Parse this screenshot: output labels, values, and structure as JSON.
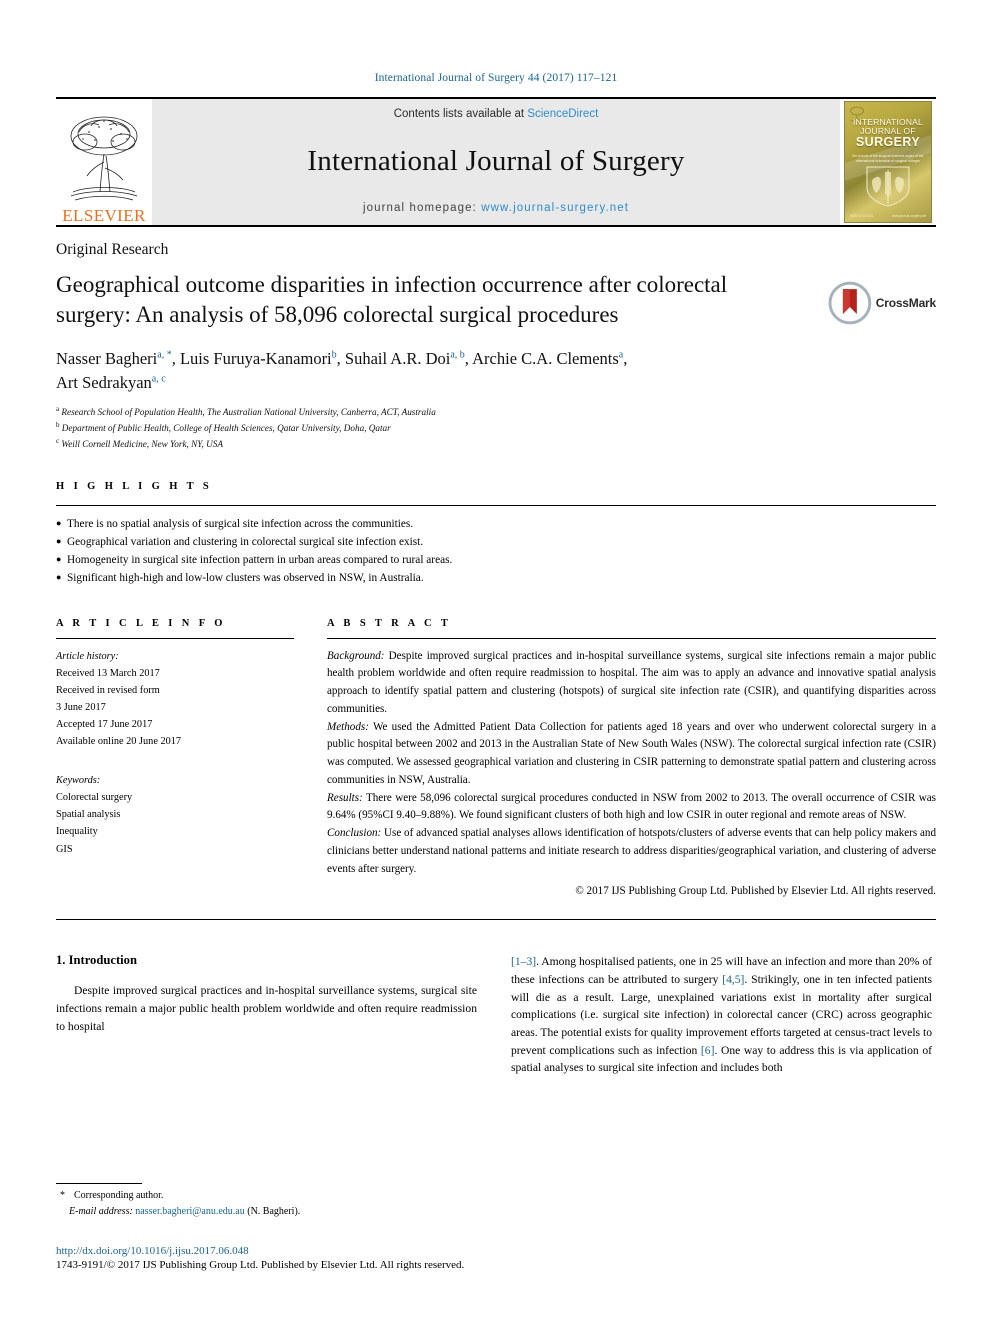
{
  "running_head": "International Journal of Surgery 44 (2017) 117–121",
  "masthead": {
    "publisher": "ELSEVIER",
    "contents_prefix": "Contents lists available at ",
    "contents_link": "ScienceDirect",
    "journal_title": "International Journal of Surgery",
    "homepage_label": "journal homepage: ",
    "homepage_url": "www.journal-surgery.net",
    "cover": {
      "line1": "INTERNATIONAL",
      "line2": "JOURNAL OF",
      "line3": "SURGERY",
      "subtitle": "the journal of the surgical sciences\norgan of the international federation of surgical colleges",
      "footer_left": "ISSN 1743-9191",
      "footer_right": "www.journal-surgery.net"
    }
  },
  "article": {
    "kind": "Original Research",
    "title": "Geographical outcome disparities in infection occurrence after colorectal surgery: An analysis of 58,096 colorectal surgical procedures",
    "crossmark_label": "CrossMark",
    "authors_line1_a": "Nasser Bagheri",
    "authors_line1_a_sup": "a, *",
    "authors_line1_b": ", Luis Furuya-Kanamori",
    "authors_line1_b_sup": "b",
    "authors_line1_c": ", Suhail A.R. Doi",
    "authors_line1_c_sup": "a, b",
    "authors_line1_d": ", Archie C.A. Clements",
    "authors_line1_d_sup": "a",
    "authors_line1_e": ",",
    "authors_line2_a": "Art Sedrakyan",
    "authors_line2_a_sup": "a, c",
    "affiliations": [
      {
        "marker": "a",
        "text": "Research School of Population Health, The Australian National University, Canberra, ACT, Australia"
      },
      {
        "marker": "b",
        "text": "Department of Public Health, College of Health Sciences, Qatar University, Doha, Qatar"
      },
      {
        "marker": "c",
        "text": "Weill Cornell Medicine, New York, NY, USA"
      }
    ]
  },
  "highlights": {
    "label": "H I G H L I G H T S",
    "bullet": "●",
    "items": [
      "There is no spatial analysis of surgical site infection across the communities.",
      "Geographical variation and clustering in colorectal surgical site infection exist.",
      "Homogeneity in surgical site infection pattern in urban areas compared to rural areas.",
      "Significant high-high and low-low clusters was observed in NSW, in Australia."
    ]
  },
  "article_info": {
    "label": "A R T I C L E  I N F O",
    "history_label": "Article history:",
    "history_lines": [
      "Received 13 March 2017",
      "Received in revised form",
      "3 June 2017",
      "Accepted 17 June 2017",
      "Available online 20 June 2017"
    ],
    "keywords_label": "Keywords:",
    "keywords": [
      "Colorectal surgery",
      "Spatial analysis",
      "Inequality",
      "GIS"
    ]
  },
  "abstract": {
    "label": "A B S T R A C T",
    "sections": [
      {
        "lead": "Background:",
        "text": " Despite improved surgical practices and in-hospital surveillance systems, surgical site infections remain a major public health problem worldwide and often require readmission to hospital. The aim was to apply an advance and innovative spatial analysis approach to identify spatial pattern and clustering (hotspots) of surgical site infection rate (CSIR), and quantifying disparities across communities."
      },
      {
        "lead": "Methods:",
        "text": " We used the Admitted Patient Data Collection for patients aged 18 years and over who underwent colorectal surgery in a public hospital between 2002 and 2013 in the Australian State of New South Wales (NSW). The colorectal surgical infection rate (CSIR) was computed. We assessed geographical variation and clustering in CSIR patterning to demonstrate spatial pattern and clustering across communities in NSW, Australia."
      },
      {
        "lead": "Results:",
        "text": " There were 58,096 colorectal surgical procedures conducted in NSW from 2002 to 2013. The overall occurrence of CSIR was 9.64% (95%CI 9.40–9.88%). We found significant clusters of both high and low CSIR in outer regional and remote areas of NSW."
      },
      {
        "lead": "Conclusion:",
        "text": " Use of advanced spatial analyses allows identification of hotspots/clusters of adverse events that can help policy makers and clinicians better understand national patterns and initiate research to address disparities/geographical variation, and clustering of adverse events after surgery."
      }
    ],
    "copyright": "© 2017 IJS Publishing Group Ltd. Published by Elsevier Ltd. All rights reserved."
  },
  "body": {
    "section_heading": "1. Introduction",
    "left_paragraph_part1": "Despite improved surgical practices and in-hospital surveillance systems, surgical site infections remain a major public health problem worldwide and often require readmission to hospital",
    "right_ref_1": "[1–3]",
    "right_text_1": ". Among hospitalised patients, one in 25 will have an infection and more than 20% of these infections can be attributed to surgery ",
    "right_ref_2": "[4,5]",
    "right_text_2": ". Strikingly, one in ten infected patients will die as a result. Large, unexplained variations exist in mortality after surgical complications (i.e. surgical site infection) in colorectal cancer (CRC) across geographic areas. The potential exists for quality improvement efforts targeted at census-tract levels to prevent complications such as infection ",
    "right_ref_3": "[6]",
    "right_text_3": ". One way to address this is via application of spatial analyses to surgical site infection and includes both"
  },
  "footnote": {
    "star": "*",
    "corresponding": "Corresponding author.",
    "email_label": "E-mail address:",
    "email": "nasser.bagheri@anu.edu.au",
    "email_suffix": " (N. Bagheri)."
  },
  "footer": {
    "doi": "http://dx.doi.org/10.1016/j.ijsu.2017.06.048",
    "issn": "1743-9191/© 2017 IJS Publishing Group Ltd. Published by Elsevier Ltd. All rights reserved."
  }
}
